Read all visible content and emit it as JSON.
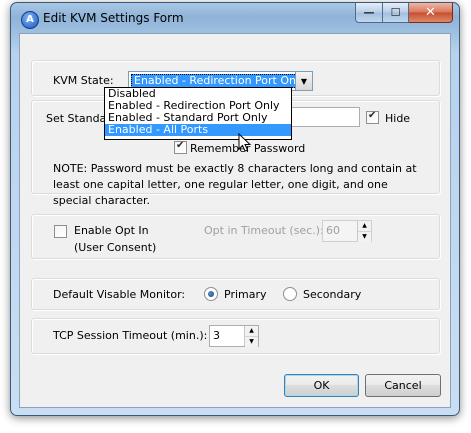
{
  "window": {
    "title": "Edit KVM Settings Form"
  },
  "caption_buttons": {
    "minimize": "—",
    "maximize": "☐",
    "close": "✕"
  },
  "kvm": {
    "label": "KVM State:",
    "selected": "Enabled - Redirection Port Only",
    "options": [
      "Disabled",
      "Enabled - Redirection Port Only",
      "Enabled - Standard Port Only",
      "Enabled - All Ports"
    ],
    "highlighted_option": "Enabled - All Ports"
  },
  "password": {
    "label": "Set Standard",
    "hide_label": "Hide",
    "hide_checked": true,
    "remember_label": "Remember Password",
    "remember_checked": true,
    "note": "NOTE: Password must be exactly 8 characters long and contain at least one capital letter, one regular letter, one digit, and one special character."
  },
  "optin": {
    "checkbox_label": "Enable Opt In",
    "checked": false,
    "sub_label": "(User Consent)",
    "timeout_label": "Opt in Timeout (sec.):",
    "timeout_value": "60"
  },
  "monitor": {
    "label": "Default Visable Monitor:",
    "primary": "Primary",
    "secondary": "Secondary",
    "selected": "Primary"
  },
  "tcp": {
    "label": "TCP Session Timeout (min.):",
    "value": "3"
  },
  "buttons": {
    "ok": "OK",
    "cancel": "Cancel"
  },
  "colors": {
    "selection": "#3399ff",
    "title_bar": "#9ec0e0",
    "close_button": "#c84d2e"
  },
  "icons": {
    "app": "app-logo-icon",
    "cursor": "mouse-pointer-icon"
  }
}
